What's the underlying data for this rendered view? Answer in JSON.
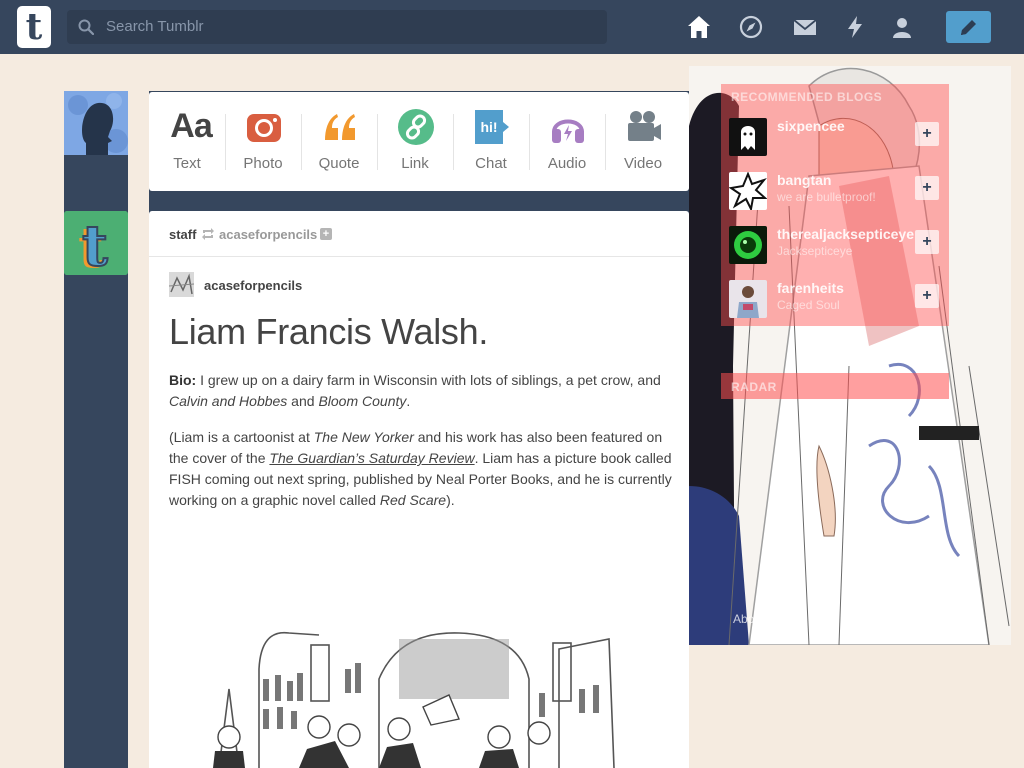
{
  "header": {
    "logo_letter": "t",
    "search_placeholder": "Search Tumblr",
    "nav_icons": [
      "home-icon",
      "compass-icon",
      "mail-icon",
      "lightning-icon",
      "account-icon"
    ],
    "compose_icon": "pencil-icon"
  },
  "post_types": [
    {
      "label": "Text",
      "icon": "Aa",
      "color": "#444444"
    },
    {
      "label": "Photo",
      "icon": "camera-icon",
      "color": "#d95e40"
    },
    {
      "label": "Quote",
      "icon": "quote-icon",
      "color": "#f2992e"
    },
    {
      "label": "Link",
      "icon": "link-icon",
      "color": "#56bc8a"
    },
    {
      "label": "Chat",
      "icon": "hi!",
      "color": "#529ecc"
    },
    {
      "label": "Audio",
      "icon": "headphones-icon",
      "color": "#a77dc2"
    },
    {
      "label": "Video",
      "icon": "video-camera-icon",
      "color": "#748089"
    }
  ],
  "post": {
    "poster": "staff",
    "source": "acaseforpencils",
    "author": "acaseforpencils",
    "title": "Liam Francis Walsh.",
    "bio_label": "Bio:",
    "bio_text_1": " I grew up on a dairy farm in Wisconsin with lots of siblings, a pet crow, and ",
    "bio_book_1": "Calvin and Hobbes",
    "bio_and": " and ",
    "bio_book_2": "Bloom County",
    "bio_end": ".",
    "p2_a": "(Liam is a cartoonist at ",
    "p2_mag": "The New Yorker",
    "p2_b": " and his work has also been featured on the cover of the ",
    "p2_link": "The Guardian’s Saturday Review",
    "p2_c": ". Liam has a picture book called FISH coming out next spring, published by Neal Porter Books, and he is currently working on a graphic novel called ",
    "p2_novel": "Red Scare",
    "p2_d": ")."
  },
  "sidebar": {
    "recommended_title": "RECOMMENDED BLOGS",
    "blogs": [
      {
        "name": "sixpencee",
        "sub": ""
      },
      {
        "name": "bangtan",
        "sub": "we are bulletproof!"
      },
      {
        "name": "therealjacksepticeye",
        "sub": "Jacksepticeye"
      },
      {
        "name": "farenheits",
        "sub": "Caged Soul"
      }
    ],
    "radar_title": "RADAR",
    "footer_about": "About"
  },
  "colors": {
    "navy": "#36465d",
    "background": "#f5ebe0",
    "accent_blue": "#529ecc"
  }
}
